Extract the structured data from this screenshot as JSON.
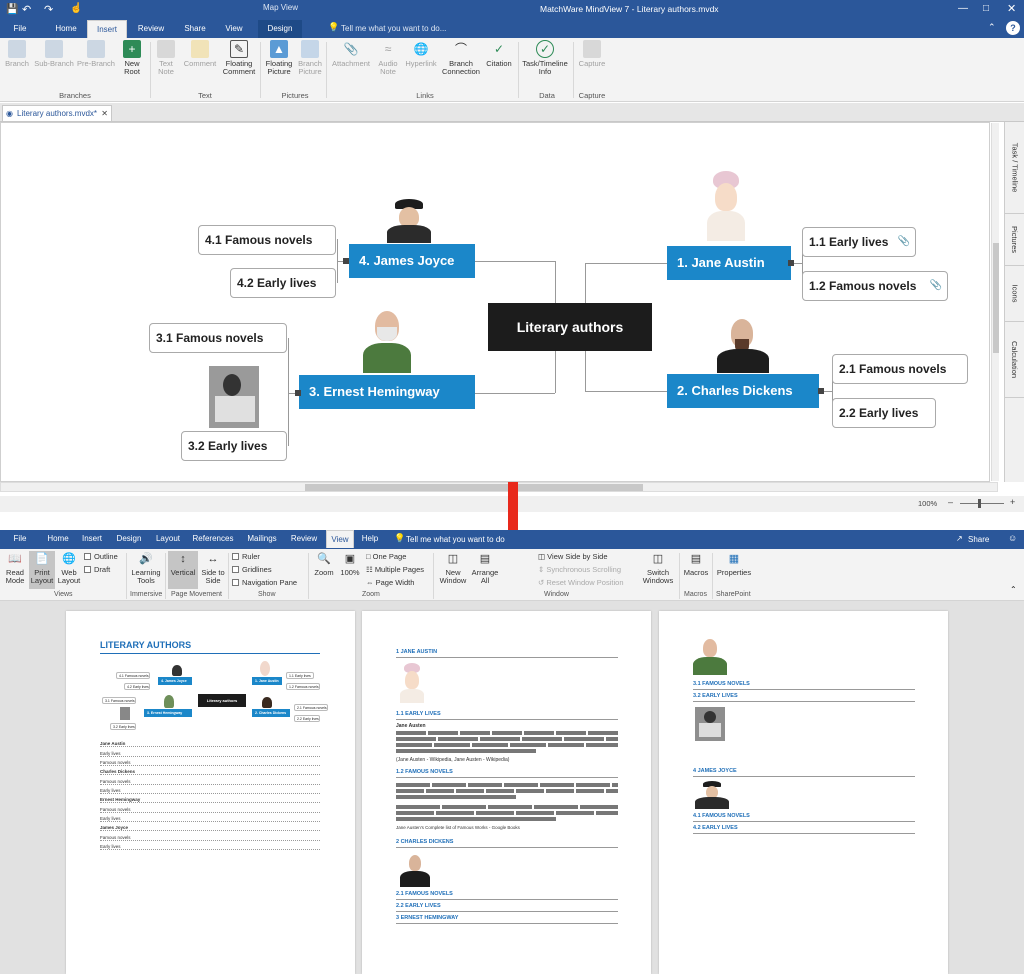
{
  "mindview": {
    "title": "MatchWare MindView 7 - Literary authors.mvdx",
    "contextual_tab_group": "Map View",
    "tell_me": "Tell me what you want to do...",
    "tabs": [
      "File",
      "Home",
      "Insert",
      "Review",
      "Share",
      "View",
      "Design"
    ],
    "active_tab": "Insert",
    "ribbon": {
      "branches": {
        "label": "Branches",
        "items": [
          "Branch",
          "Sub-Branch",
          "Pre-Branch",
          "New Root"
        ]
      },
      "text": {
        "label": "Text",
        "items": [
          "Text Note",
          "Comment",
          "Floating Comment"
        ]
      },
      "pictures": {
        "label": "Pictures",
        "items": [
          "Floating Picture",
          "Branch Picture"
        ]
      },
      "links": {
        "label": "Links",
        "items": [
          "Attachment",
          "Audio Note",
          "Hyperlink",
          "Branch Connection",
          "Citation"
        ]
      },
      "data": {
        "label": "Data",
        "items": [
          "Task/Timeline Info"
        ]
      },
      "capture": {
        "label": "Capture",
        "items": [
          "Capture"
        ]
      }
    },
    "doc_tab": "Literary authors.mvdx*",
    "side_tabs": [
      "Task / Timeline",
      "Pictures",
      "Icons",
      "Calculation"
    ],
    "zoom": "100%",
    "map": {
      "root": "Literary authors",
      "branches": [
        {
          "label": "1.  Jane Austin",
          "children": [
            "1.1  Early lives",
            "1.2  Famous novels"
          ]
        },
        {
          "label": "2.  Charles Dickens",
          "children": [
            "2.1  Famous novels",
            "2.2  Early lives"
          ]
        },
        {
          "label": "3.  Ernest Hemingway",
          "children": [
            "3.1  Famous novels",
            "3.2  Early lives"
          ]
        },
        {
          "label": "4.  James Joyce",
          "children": [
            "4.1  Famous novels",
            "4.2  Early lives"
          ]
        }
      ]
    }
  },
  "word": {
    "tabs": [
      "File",
      "Home",
      "Insert",
      "Design",
      "Layout",
      "References",
      "Mailings",
      "Review",
      "View",
      "Help"
    ],
    "active_tab": "View",
    "tell_me": "Tell me what you want to do",
    "share": "Share",
    "ribbon": {
      "views": {
        "label": "Views",
        "items": [
          "Read Mode",
          "Print Layout",
          "Web Layout"
        ],
        "checks": [
          "Outline",
          "Draft"
        ]
      },
      "immersive": {
        "label": "Immersive",
        "items": [
          "Learning Tools"
        ]
      },
      "page_movement": {
        "label": "Page Movement",
        "items": [
          "Vertical",
          "Side to Side"
        ]
      },
      "show": {
        "label": "Show",
        "checks": [
          "Ruler",
          "Gridlines",
          "Navigation Pane"
        ]
      },
      "zoom": {
        "label": "Zoom",
        "items": [
          "Zoom",
          "100%"
        ],
        "small": [
          "One Page",
          "Multiple Pages",
          "Page Width"
        ]
      },
      "window": {
        "label": "Window",
        "items": [
          "New Window",
          "Arrange All"
        ],
        "small": [
          "View Side by Side",
          "Synchronous Scrolling",
          "Reset Window Position"
        ],
        "switch": "Switch Windows"
      },
      "macros": {
        "label": "Macros",
        "items": [
          "Macros"
        ]
      },
      "sharepoint": {
        "label": "SharePoint",
        "items": [
          "Properties"
        ]
      }
    },
    "page1": {
      "title": "LITERARY AUTHORS",
      "toc": [
        "Jane Austin",
        "Early lives",
        "Famous novels",
        "Charles Dickens",
        "Famous novels",
        "Early lives",
        "Ernest Hemingway",
        "Famous novels",
        "Early lives",
        "James Joyce",
        "Famous novels",
        "Early lives"
      ]
    },
    "page2": {
      "h1": "1    JANE AUSTIN",
      "h11": "1.1   EARLY LIVES",
      "lead": "Jane Austen",
      "citation": "(Jane Austen - Wikipedia, Jane Austen - Wikipedia)",
      "h12": "1.2   FAMOUS NOVELS",
      "note": "Jane Austen's Complete list of Famous Works - Google Books",
      "h2": "2    CHARLES DICKENS",
      "h21": "2.1   FAMOUS NOVELS",
      "h22": "2.2   EARLY LIVES",
      "h3": "3    ERNEST HEMINGWAY"
    },
    "page3": {
      "h31": "3.1   FAMOUS NOVELS",
      "h32": "3.2   EARLY LIVES",
      "h4": "4    JAMES JOYCE",
      "h41": "4.1   FAMOUS NOVELS",
      "h42": "4.2   EARLY LIVES"
    }
  },
  "colors": {
    "title_bar": "#2b579a",
    "branch": "#1b87c9",
    "root": "#1c1c1c",
    "arrow": "#e8291c",
    "heading": "#1f6fb8"
  }
}
